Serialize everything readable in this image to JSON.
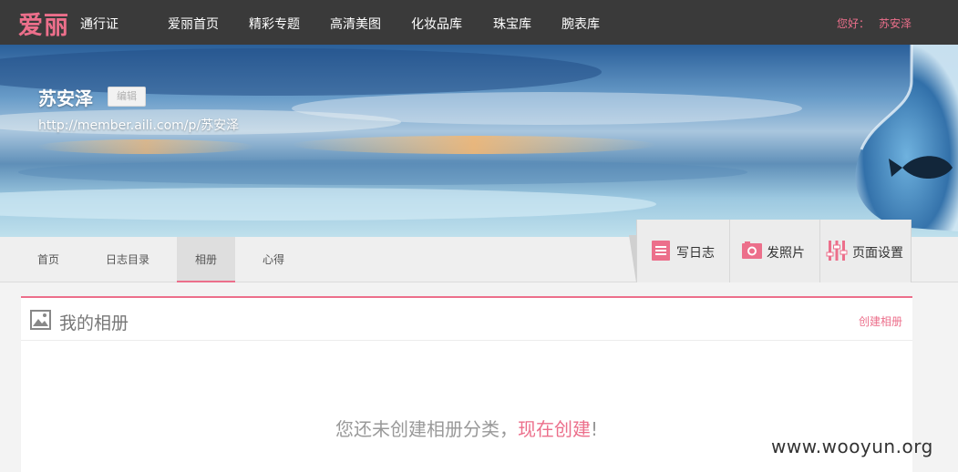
{
  "header": {
    "logo": "爱丽",
    "passport": "通行证",
    "nav": [
      "爱丽首页",
      "精彩专题",
      "高清美图",
      "化妆品库",
      "珠宝库",
      "腕表库"
    ],
    "greeting": "您好：",
    "username": "苏安泽"
  },
  "profile": {
    "name": "苏安泽",
    "edit_label": "编辑",
    "url": "http://member.aili.com/p/苏安泽"
  },
  "tabs": [
    "首页",
    "日志目录",
    "相册",
    "心得"
  ],
  "actions": [
    "写日志",
    "发照片",
    "页面设置"
  ],
  "album": {
    "title": "我的相册",
    "create_label": "创建相册",
    "empty_text": "您还未创建相册分类，",
    "empty_link": "现在创建",
    "empty_suffix": "!"
  },
  "watermark": "www.wooyun.org",
  "colors": {
    "accent": "#ec6f8b",
    "topbar": "#3a3a3a"
  }
}
